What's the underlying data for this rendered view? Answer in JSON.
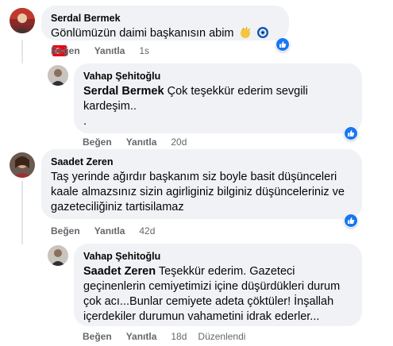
{
  "comments": [
    {
      "author": "Serdal Bermek",
      "text": "Gönlümüzün daimi başkanısın abim",
      "like_label": "Beğen",
      "reply_label": "Yanıtla",
      "time": "1s",
      "emojis": [
        "clapping-hands-emoji",
        "nazar-bead-emoji",
        "turkey-flag-emoji"
      ]
    },
    {
      "author": "Vahap Şehitoğlu",
      "mention": "Serdal Bermek",
      "text": " Çok teşekkür ederim sevgili",
      "text_line2": "kardeşim..",
      "text_line3": ".",
      "like_label": "Beğen",
      "reply_label": "Yanıtla",
      "time": "20d"
    },
    {
      "author": "Saadet Zeren",
      "text_line1": "Taş yerinde ağırdır başkanım siz boyle basit düşünceleri",
      "text_line2": "kaale almazsınız sizin agirliginiz bilginiz düşünceleriniz ve",
      "text_line3": "gazeteciliğiniz tartisilamaz",
      "like_label": "Beğen",
      "reply_label": "Yanıtla",
      "time": "42d"
    },
    {
      "author": "Vahap Şehitoğlu",
      "mention": "Saadet Zeren",
      "text_line1": " Teşekkür ederim. Gazeteci",
      "text_line2": "geçinenlerin cemiyetimizi içine düşürdükleri durum",
      "text_line3": "çok acı...Bunlar cemiyete adeta çöktüler! İnşallah",
      "text_line4": "içerdekiler durumun vahametini idrak ederler...",
      "like_label": "Beğen",
      "reply_label": "Yanıtla",
      "time": "18d",
      "edited_label": "Düzenlendi"
    }
  ],
  "colors": {
    "bubble": "#f0f2f5",
    "meta_text": "#65676b",
    "like_blue": "#1877f2",
    "thread_line": "#e4e6eb"
  }
}
